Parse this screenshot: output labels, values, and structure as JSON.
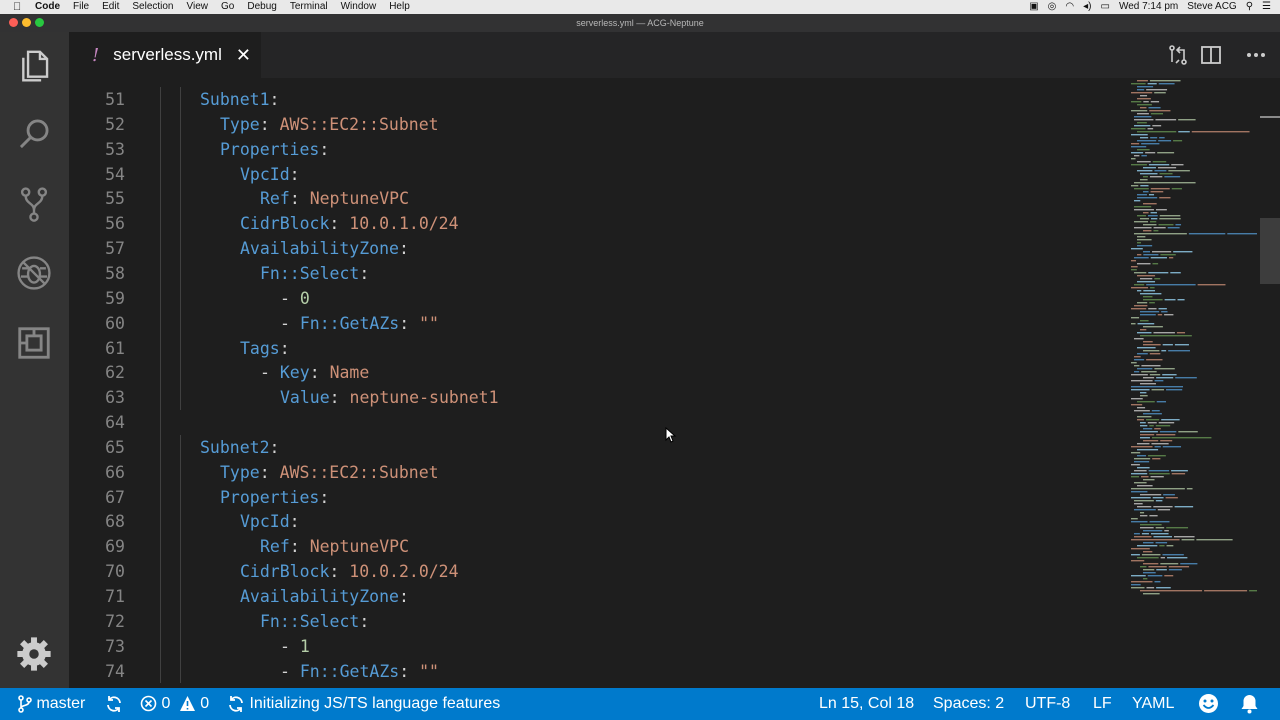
{
  "menubar": {
    "app": "Code",
    "items": [
      "File",
      "Edit",
      "Selection",
      "View",
      "Go",
      "Debug",
      "Terminal",
      "Window",
      "Help"
    ],
    "clock": "Wed 7:14 pm",
    "user": "Steve ACG"
  },
  "window": {
    "title": "serverless.yml — ACG-Neptune"
  },
  "tab": {
    "modified_marker": "!",
    "filename": "serverless.yml",
    "close": "✕"
  },
  "editor": {
    "lines": [
      {
        "n": "51",
        "t": [
          [
            "k",
            "Subnet1"
          ],
          [
            "p",
            ":"
          ]
        ]
      },
      {
        "n": "52",
        "t": [
          [
            "k",
            "Type"
          ],
          [
            "p",
            ": "
          ],
          [
            "s",
            "AWS::EC2::Subnet"
          ]
        ]
      },
      {
        "n": "53",
        "t": [
          [
            "k",
            "Properties"
          ],
          [
            "p",
            ":"
          ]
        ]
      },
      {
        "n": "54",
        "t": [
          [
            "k",
            "VpcId"
          ],
          [
            "p",
            ":"
          ]
        ]
      },
      {
        "n": "55",
        "t": [
          [
            "k",
            "Ref"
          ],
          [
            "p",
            ": "
          ],
          [
            "s",
            "NeptuneVPC"
          ]
        ]
      },
      {
        "n": "56",
        "t": [
          [
            "k",
            "CidrBlock"
          ],
          [
            "p",
            ": "
          ],
          [
            "s",
            "10.0.1.0/24"
          ]
        ]
      },
      {
        "n": "57",
        "t": [
          [
            "k",
            "AvailabilityZone"
          ],
          [
            "p",
            ":"
          ]
        ]
      },
      {
        "n": "58",
        "t": [
          [
            "k",
            "Fn::Select"
          ],
          [
            "p",
            ":"
          ]
        ]
      },
      {
        "n": "59",
        "t": [
          [
            "p",
            "- "
          ],
          [
            "n",
            "0"
          ]
        ]
      },
      {
        "n": "60",
        "t": [
          [
            "p",
            "- "
          ],
          [
            "k",
            "Fn::GetAZs"
          ],
          [
            "p",
            ": "
          ],
          [
            "s",
            "\"\""
          ]
        ]
      },
      {
        "n": "61",
        "t": [
          [
            "k",
            "Tags"
          ],
          [
            "p",
            ":"
          ]
        ]
      },
      {
        "n": "62",
        "t": [
          [
            "p",
            "- "
          ],
          [
            "k",
            "Key"
          ],
          [
            "p",
            ": "
          ],
          [
            "s",
            "Name"
          ]
        ]
      },
      {
        "n": "63",
        "t": [
          [
            "k",
            "Value"
          ],
          [
            "p",
            ": "
          ],
          [
            "s",
            "neptune-subnet1"
          ]
        ]
      },
      {
        "n": "64",
        "t": []
      },
      {
        "n": "65",
        "t": [
          [
            "k",
            "Subnet2"
          ],
          [
            "p",
            ":"
          ]
        ]
      },
      {
        "n": "66",
        "t": [
          [
            "k",
            "Type"
          ],
          [
            "p",
            ": "
          ],
          [
            "s",
            "AWS::EC2::Subnet"
          ]
        ]
      },
      {
        "n": "67",
        "t": [
          [
            "k",
            "Properties"
          ],
          [
            "p",
            ":"
          ]
        ]
      },
      {
        "n": "68",
        "t": [
          [
            "k",
            "VpcId"
          ],
          [
            "p",
            ":"
          ]
        ]
      },
      {
        "n": "69",
        "t": [
          [
            "k",
            "Ref"
          ],
          [
            "p",
            ": "
          ],
          [
            "s",
            "NeptuneVPC"
          ]
        ]
      },
      {
        "n": "70",
        "t": [
          [
            "k",
            "CidrBlock"
          ],
          [
            "p",
            ": "
          ],
          [
            "s",
            "10.0.2.0/24"
          ]
        ]
      },
      {
        "n": "71",
        "t": [
          [
            "k",
            "AvailabilityZone"
          ],
          [
            "p",
            ":"
          ]
        ]
      },
      {
        "n": "72",
        "t": [
          [
            "k",
            "Fn::Select"
          ],
          [
            "p",
            ":"
          ]
        ]
      },
      {
        "n": "73",
        "t": [
          [
            "p",
            "- "
          ],
          [
            "n",
            "1"
          ]
        ]
      },
      {
        "n": "74",
        "t": [
          [
            "p",
            "- "
          ],
          [
            "k",
            "Fn::GetAZs"
          ],
          [
            "p",
            ": "
          ],
          [
            "s",
            "\"\""
          ]
        ]
      }
    ]
  },
  "statusbar": {
    "branch": "master",
    "errors": "0",
    "warnings": "0",
    "task": "Initializing JS/TS language features",
    "position": "Ln 15, Col 18",
    "spaces": "Spaces: 2",
    "encoding": "UTF-8",
    "eol": "LF",
    "language": "YAML"
  },
  "colors": {
    "statusbar": "#007acc",
    "key": "#569cd6",
    "string": "#ce9178",
    "number": "#b5cea8",
    "activitybar": "#333333"
  },
  "icons": [
    "explorer-icon",
    "search-icon",
    "source-control-icon",
    "debug-icon",
    "extensions-icon",
    "gear-icon",
    "open-changes-icon",
    "split-editor-icon",
    "more-actions-icon",
    "branch-icon",
    "sync-icon",
    "error-icon",
    "warning-icon",
    "smiley-icon",
    "bell-icon"
  ]
}
